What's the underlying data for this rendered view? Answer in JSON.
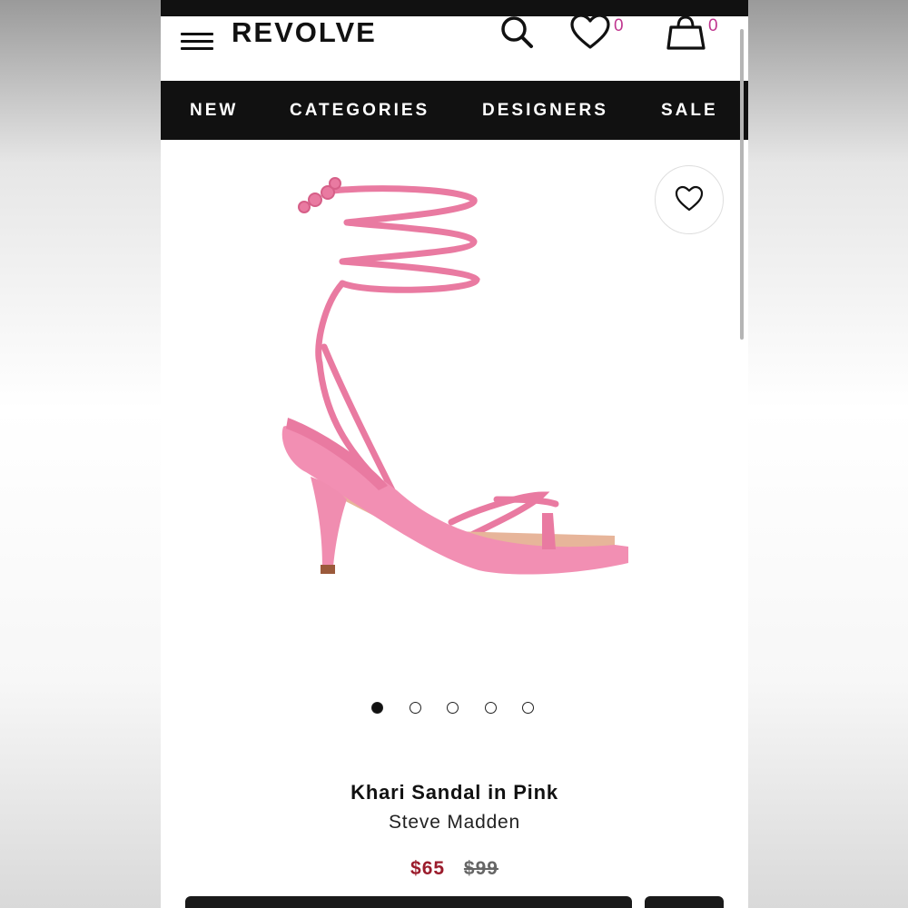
{
  "app": {
    "logo": "REVOLVE"
  },
  "header": {
    "wishlist_count": "0",
    "bag_count": "0",
    "icons": [
      "menu-icon",
      "search-icon",
      "heart-icon",
      "bag-icon"
    ]
  },
  "nav": {
    "items": [
      {
        "label": "NEW"
      },
      {
        "label": "CATEGORIES"
      },
      {
        "label": "DESIGNERS"
      },
      {
        "label": "SALE"
      }
    ]
  },
  "product": {
    "title": "Khari Sandal in Pink",
    "brand": "Steve Madden",
    "price_sale": "$65",
    "price_original": "$99",
    "image_count": 5,
    "active_image_index": 0
  },
  "colors": {
    "accent_count": "#c0368f",
    "sale_price": "#9b1c2c",
    "nav_bg": "#111111",
    "product_pink": "#e97aa1"
  }
}
